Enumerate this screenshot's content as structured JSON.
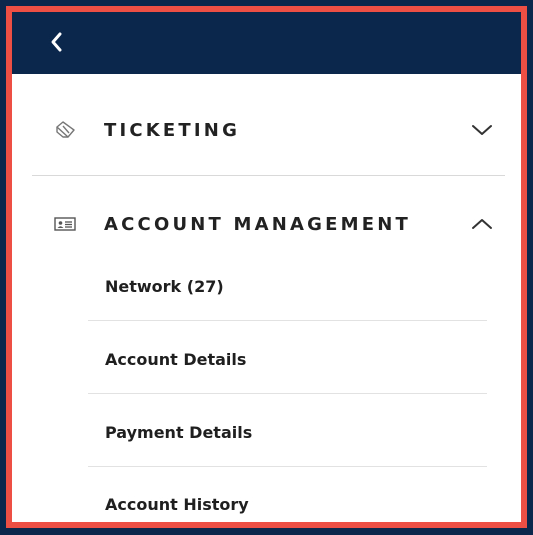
{
  "menu": {
    "sections": [
      {
        "label": "TICKETING",
        "icon": "ticket-icon",
        "expanded": false
      },
      {
        "label": "ACCOUNT MANAGEMENT",
        "icon": "id-card-icon",
        "expanded": true,
        "items": [
          {
            "label": "Network (27)"
          },
          {
            "label": "Account Details"
          },
          {
            "label": "Payment Details"
          },
          {
            "label": "Account History"
          }
        ]
      }
    ]
  },
  "colors": {
    "header_bg": "#0b274c",
    "frame_border": "#ee4f45",
    "text": "#222222"
  }
}
